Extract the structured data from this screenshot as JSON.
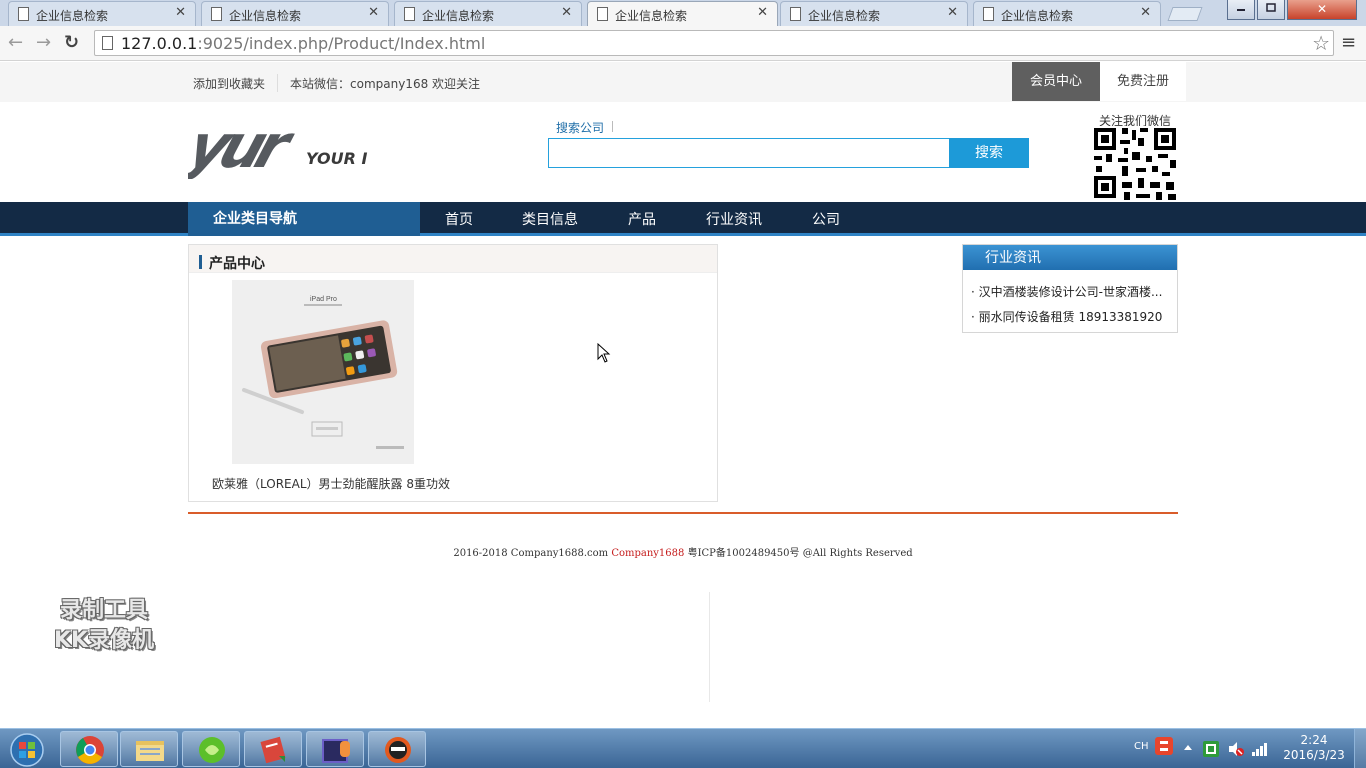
{
  "browser": {
    "tabs": [
      {
        "label": "企业信息检索",
        "active": false
      },
      {
        "label": "企业信息检索",
        "active": false
      },
      {
        "label": "企业信息检索",
        "active": false
      },
      {
        "label": "企业信息检索",
        "active": true
      },
      {
        "label": "企业信息检索",
        "active": false
      },
      {
        "label": "企业信息检索",
        "active": false
      }
    ],
    "url_host": "127.0.0.1",
    "url_rest": ":9025/index.php/Product/Index.html",
    "close_glyph": "✕",
    "back_glyph": "←",
    "forward_glyph": "→",
    "reload_glyph": "↻",
    "star_glyph": "☆",
    "menu_glyph": "≡"
  },
  "topbar": {
    "bookmark": "添加到收藏夹",
    "wechat": "本站微信：company168 欢迎关注",
    "member_center": "会员中心",
    "register": "免费注册"
  },
  "logo": {
    "mark": "yur",
    "text": "YOUR I"
  },
  "search": {
    "tab_label": "搜索公司",
    "placeholder": "",
    "button": "搜索"
  },
  "qr": {
    "label": "关注我们微信"
  },
  "nav": {
    "category": "企业类目导航",
    "items": [
      "首页",
      "类目信息",
      "产品",
      "行业资讯",
      "公司"
    ]
  },
  "products": {
    "title": "产品中心",
    "image_text": "iPad Pro",
    "item_caption": "欧莱雅（LOREAL）男士劲能醒肤露 8重功效"
  },
  "news": {
    "title": "行业资讯",
    "items": [
      "汉中酒楼装修设计公司-世家酒楼...",
      "丽水同传设备租赁 18913381920"
    ]
  },
  "footer": {
    "prefix": "2016-2018 Company1688.com ",
    "brand": "Company1688",
    "suffix": " 粤ICP备1002489450号 @All Rights Reserved"
  },
  "watermark": {
    "line1": "录制工具",
    "line2": "KK录像机"
  },
  "taskbar": {
    "ime": "CH",
    "time": "2:24",
    "date": "2016/3/23"
  },
  "colors": {
    "nav_bg": "#132a45",
    "nav_accent": "#1f5e93",
    "search_blue": "#1d9ad8",
    "footer_rule": "#d95c2a",
    "brand_red": "#c51d1d"
  }
}
